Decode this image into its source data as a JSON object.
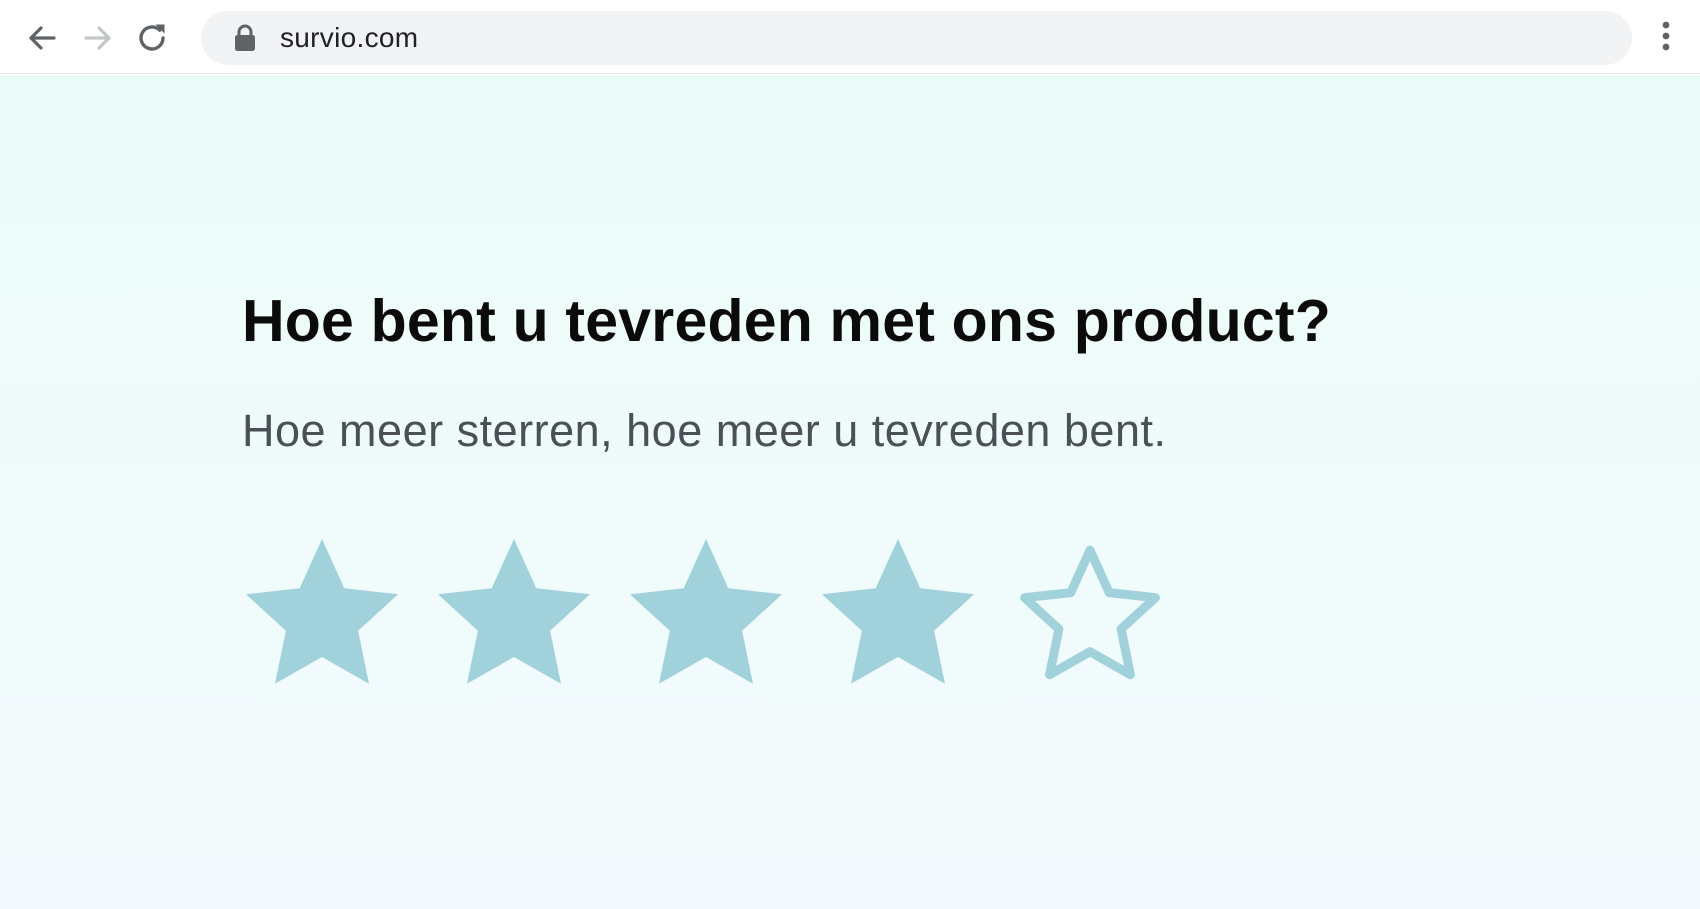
{
  "browser": {
    "url": "survio.com",
    "icons": {
      "back": "arrow-left-icon",
      "forward": "arrow-right-icon",
      "reload": "reload-icon",
      "lock": "lock-icon",
      "menu": "more-vertical-icon"
    }
  },
  "survey": {
    "question": "Hoe bent u tevreden met ons product?",
    "hint": "Hoe meer sterren, hoe meer u tevreden bent.",
    "rating": {
      "value": 4,
      "max": 5,
      "star_color": "#a1d1db"
    }
  },
  "colors": {
    "page_background": "#eefcfb",
    "title": "#0b0b0b",
    "hint": "#4a5055",
    "omnibox": "#f1f3f4"
  }
}
